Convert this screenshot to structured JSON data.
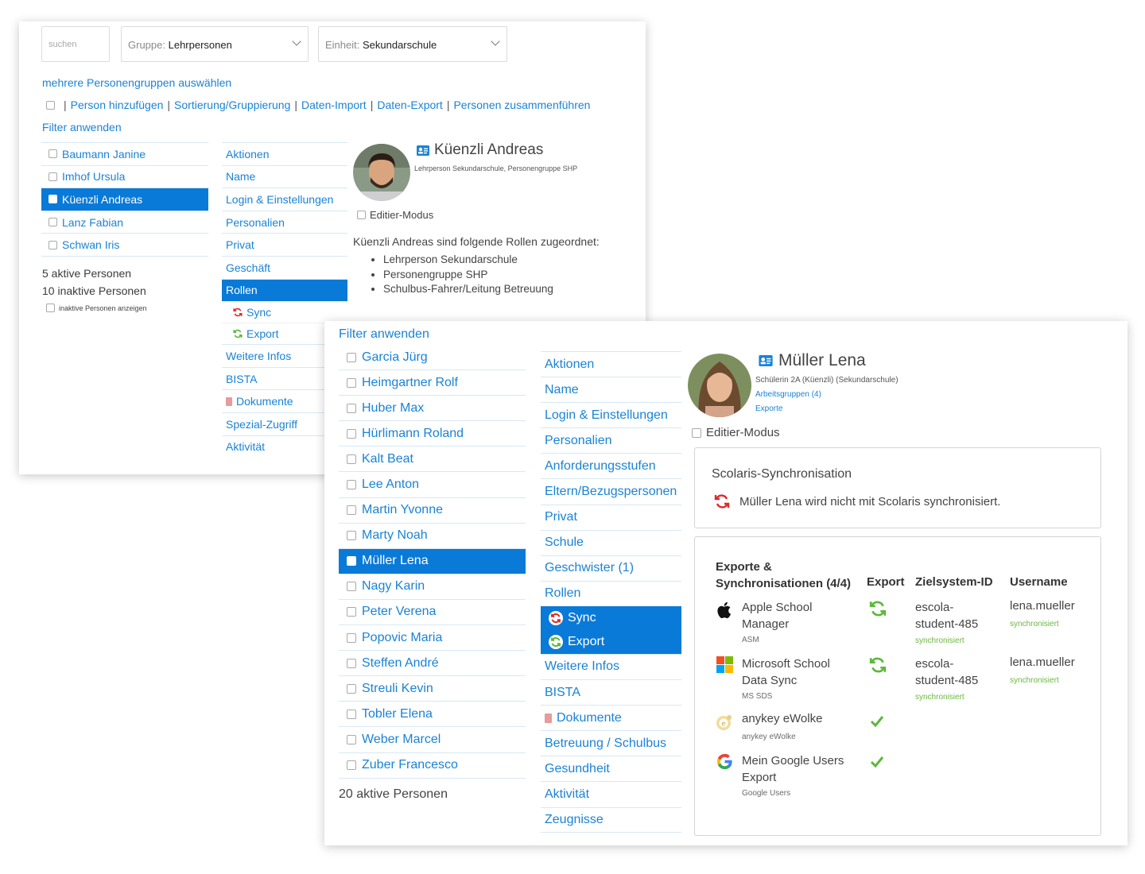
{
  "window1": {
    "search": {
      "placeholder": "suchen"
    },
    "group_select": {
      "prefix": "Gruppe",
      "value": "Lehrpersonen"
    },
    "unit_select": {
      "prefix": "Einheit",
      "value": "Sekundarschule"
    },
    "multi_group_link": "mehrere Personengruppen auswählen",
    "action_links": [
      "Person hinzufügen",
      "Sortierung/Gruppierung",
      "Daten-Import",
      "Daten-Export",
      "Personen zusammenführen"
    ],
    "separator": "|",
    "filter_link": "Filter anwenden",
    "persons": [
      "Baumann Janine",
      "Imhof Ursula",
      "Küenzli Andreas",
      "Lanz Fabian",
      "Schwan Iris"
    ],
    "selected_person_index": 2,
    "active_count": "5 aktive Personen",
    "inactive_count": "10 inaktive Personen",
    "show_inactive_label": "inaktive Personen anzeigen",
    "nav": [
      "Aktionen",
      "Name",
      "Login & Einstellungen",
      "Personalien",
      "Privat",
      "Geschäft",
      "Rollen"
    ],
    "nav_sub": [
      "Sync",
      "Export"
    ],
    "nav_after": [
      "Weitere Infos",
      "BISTA",
      "Dokumente",
      "Spezial-Zugriff",
      "Aktivität"
    ],
    "profile": {
      "name": "Küenzli Andreas",
      "subtitle": "Lehrperson Sekundarschule, Personengruppe SHP",
      "edit_mode_label": "Editier-Modus",
      "roles_intro": "Küenzli Andreas sind folgende Rollen zugeordnet:",
      "roles": [
        "Lehrperson Sekundarschule",
        "Personengruppe SHP",
        "Schulbus-Fahrer/Leitung Betreuung"
      ]
    }
  },
  "window2": {
    "filter_link": "Filter anwenden",
    "persons": [
      "Garcia Jürg",
      "Heimgartner Rolf",
      "Huber Max",
      "Hürlimann Roland",
      "Kalt Beat",
      "Lee Anton",
      "Martin Yvonne",
      "Marty Noah",
      "Müller Lena",
      "Nagy Karin",
      "Peter Verena",
      "Popovic Maria",
      "Steffen André",
      "Streuli Kevin",
      "Tobler Elena",
      "Weber Marcel",
      "Zuber Francesco"
    ],
    "selected_person_index": 8,
    "active_count": "20 aktive Personen",
    "nav": [
      "Aktionen",
      "Name",
      "Login & Einstellungen",
      "Personalien",
      "Anforderungsstufen",
      "Eltern/Bezugspersonen",
      "Privat",
      "Schule",
      "Geschwister (1)",
      "Rollen"
    ],
    "nav_sub": [
      "Sync",
      "Export"
    ],
    "nav_after": [
      "Weitere Infos",
      "BISTA",
      "Dokumente",
      "Betreuung / Schulbus",
      "Gesundheit",
      "Aktivität",
      "Zeugnisse"
    ],
    "profile": {
      "name": "Müller Lena",
      "subtitle": "Schülerin 2A (Küenzli) (Sekundarschule)",
      "link1": "Arbeitsgruppen (4)",
      "link2": "Exporte",
      "edit_mode_label": "Editier-Modus"
    },
    "sync_panel": {
      "title": "Scolaris-Synchronisation",
      "message": "Müller Lena wird nicht mit Scolaris synchronisiert."
    },
    "export_panel": {
      "headers": {
        "col1_line1": "Exporte &",
        "col1_line2": "Synchronisationen (4/4)",
        "col2": "Export",
        "col3": "Zielsystem-ID",
        "col4": "Username"
      },
      "rows": [
        {
          "icon": "apple-icon",
          "name_line1": "Apple School",
          "name_line2": "Manager",
          "short": "ASM",
          "status": "sync",
          "target_line1": "escola-",
          "target_line2": "student-485",
          "target_status": "synchronisiert",
          "username": "lena.mueller",
          "username_status": "synchronisiert"
        },
        {
          "icon": "microsoft-icon",
          "name_line1": "Microsoft School",
          "name_line2": "Data Sync",
          "short": "MS SDS",
          "status": "sync",
          "target_line1": "escola-",
          "target_line2": "student-485",
          "target_status": "synchronisiert",
          "username": "lena.mueller",
          "username_status": "synchronisiert"
        },
        {
          "icon": "anykey-icon",
          "name_line1": "anykey eWolke",
          "name_line2": "",
          "short": "anykey eWolke",
          "status": "check"
        },
        {
          "icon": "google-icon",
          "name_line1": "Mein Google Users",
          "name_line2": "Export",
          "short": "Google Users",
          "status": "check"
        }
      ]
    }
  },
  "colors": {
    "accent": "#0a7ad8",
    "link": "#1a83d6",
    "sync_red": "#e02a2a",
    "sync_green": "#5cb83a"
  }
}
